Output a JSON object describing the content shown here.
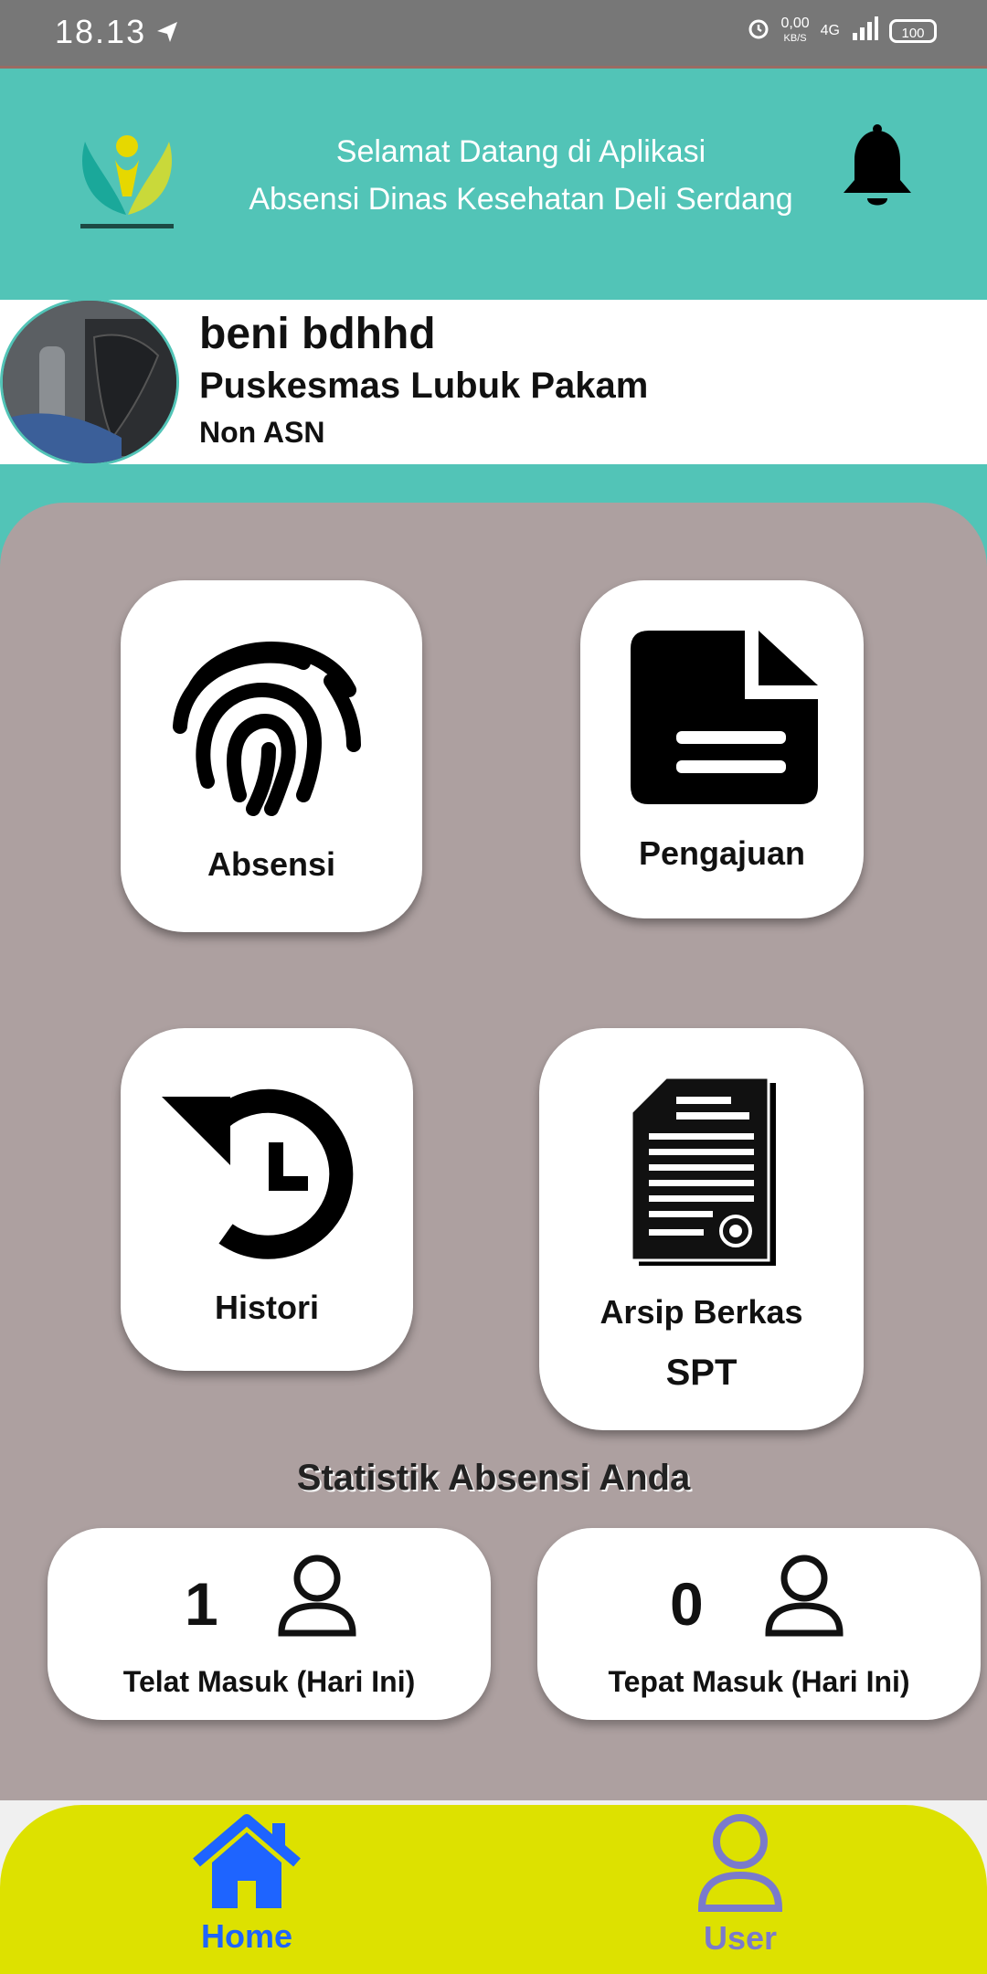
{
  "status_bar": {
    "time": "18.13",
    "speed_top": "0,00",
    "speed_bottom": "KB/S",
    "network": "4G",
    "battery": "100"
  },
  "header": {
    "welcome_line1": "Selamat Datang di Aplikasi",
    "welcome_line2": "Absensi Dinas Kesehatan Deli Serdang"
  },
  "profile": {
    "name": "beni bdhhd",
    "unit": "Puskesmas Lubuk Pakam",
    "status": "Non ASN"
  },
  "menu": {
    "absensi_label": "Absensi",
    "pengajuan_label": "Pengajuan",
    "histori_label": "Histori",
    "arsip_label_line1": "Arsip Berkas",
    "arsip_label_line2": "SPT"
  },
  "stats": {
    "title": "Statistik Absensi Anda",
    "late": {
      "value": "1",
      "label": "Telat Masuk (Hari Ini)"
    },
    "ontime": {
      "value": "0",
      "label": "Tepat Masuk (Hari Ini)"
    }
  },
  "bottom_nav": {
    "home_label": "Home",
    "user_label": "User"
  },
  "colors": {
    "header_teal": "#52c4b7",
    "panel_gray": "#ada0a0",
    "nav_yellow": "#dde100",
    "nav_active": "#1e64ff",
    "nav_inactive": "#7a7acc"
  }
}
